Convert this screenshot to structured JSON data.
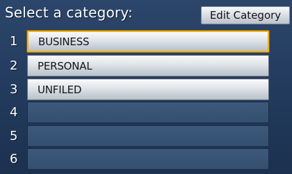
{
  "header": {
    "title": "Select a category:",
    "edit_button_label": "Edit Category"
  },
  "list": {
    "selected_index": 0,
    "rows": [
      {
        "number": "1",
        "label": "BUSINESS"
      },
      {
        "number": "2",
        "label": "PERSONAL"
      },
      {
        "number": "3",
        "label": "UNFILED"
      },
      {
        "number": "4",
        "label": ""
      },
      {
        "number": "5",
        "label": ""
      },
      {
        "number": "6",
        "label": ""
      }
    ]
  },
  "colors": {
    "background": "#2c466b",
    "selection_highlight": "#f2b21a",
    "button_face": "#d9dde3"
  }
}
